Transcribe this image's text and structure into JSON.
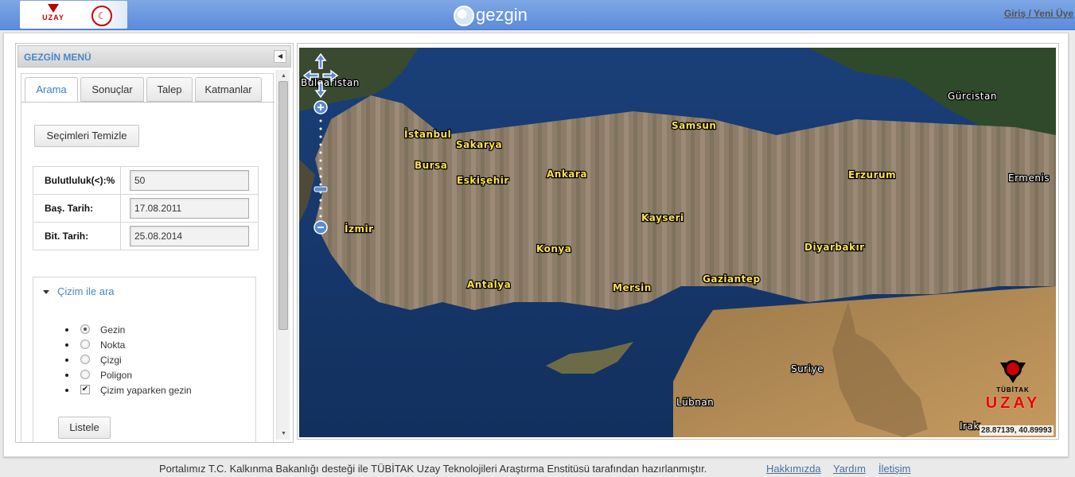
{
  "header": {
    "brand": "gezgin",
    "login_link": "Giriş / Yeni Üye",
    "logo_left_text": "UZAY",
    "logo_ministry": "☾"
  },
  "menu": {
    "title": "GEZGİN MENÜ",
    "tabs": [
      {
        "label": "Arama",
        "active": true
      },
      {
        "label": "Sonuçlar",
        "active": false
      },
      {
        "label": "Talep",
        "active": false
      },
      {
        "label": "Katmanlar",
        "active": false
      }
    ],
    "clear_button": "Seçimleri Temizle",
    "filters": [
      {
        "label": "Bulutluluk(<):%",
        "value": "50"
      },
      {
        "label": "Baş. Tarih:",
        "value": "17.08.2011"
      },
      {
        "label": "Bit. Tarih:",
        "value": "25.08.2014"
      }
    ],
    "draw": {
      "heading": "Çizim ile ara",
      "options": [
        {
          "label": "Gezin",
          "type": "radio",
          "checked": true
        },
        {
          "label": "Nokta",
          "type": "radio",
          "checked": false
        },
        {
          "label": "Çizgi",
          "type": "radio",
          "checked": false
        },
        {
          "label": "Poligon",
          "type": "radio",
          "checked": false
        },
        {
          "label": "Çizim yaparken gezin",
          "type": "checkbox",
          "checked": true
        }
      ],
      "list_button": "Listele"
    }
  },
  "map": {
    "cities": [
      "İstanbul",
      "Sakarya",
      "Bursa",
      "Eskişehir",
      "Ankara",
      "Samsun",
      "Erzurum",
      "Kayseri",
      "İzmir",
      "Konya",
      "Diyarbakır",
      "Antalya",
      "Mersin",
      "Gaziantep"
    ],
    "countries": [
      "Bulgaristan",
      "Gürcistan",
      "Ermenis",
      "Suriye",
      "Lübnan",
      "Irak"
    ],
    "coordinates": "28.87139, 40.89993",
    "logo_small": "TÜBİTAK",
    "logo_big": "UZAY",
    "colors": {
      "sea": "#173a70",
      "land": "#8a7a64",
      "desert": "#b8905a"
    }
  },
  "footer": {
    "text": "Portalımız T.C. Kalkınma Bakanlığı desteği ile TÜBİTAK Uzay Teknolojileri Araştırma Enstitüsü tarafından hazırlanmıştır.",
    "links": [
      "Hakkımızda",
      "Yardım",
      "İletişim"
    ]
  }
}
